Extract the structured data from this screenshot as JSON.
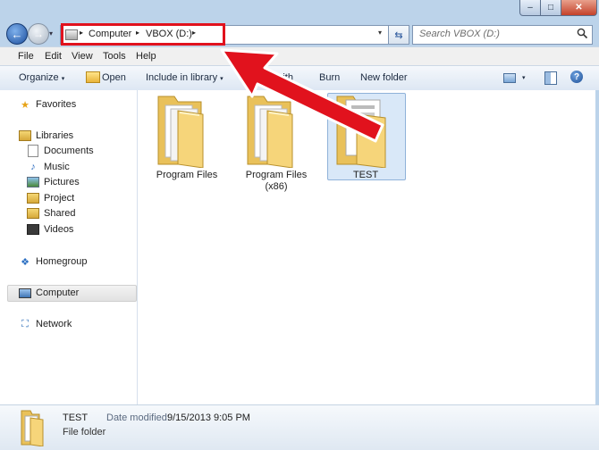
{
  "window": {
    "minimize_glyph": "–",
    "maximize_glyph": "□",
    "close_glyph": "✕"
  },
  "nav": {
    "back_glyph": "←",
    "forward_glyph": "→",
    "history_glyph": "▾"
  },
  "address": {
    "crumbs": [
      "Computer",
      "VBOX (D:)"
    ],
    "separator_glyph": "▸",
    "dropdown_glyph": "▾",
    "refresh_glyph": "⇆"
  },
  "search": {
    "placeholder": "Search VBOX (D:)",
    "icon": "search-icon"
  },
  "menu": [
    "File",
    "Edit",
    "View",
    "Tools",
    "Help"
  ],
  "toolbar": {
    "organize": "Organize",
    "open": "Open",
    "include_library": "Include in library",
    "share_with": "Share with",
    "burn": "Burn",
    "new_folder": "New folder",
    "caret": "▾",
    "view_caret": "▾",
    "help_glyph": "?"
  },
  "sidebar": {
    "favorites": "Favorites",
    "libraries": "Libraries",
    "library_items": [
      "Documents",
      "Music",
      "Pictures",
      "Project",
      "Shared",
      "Videos"
    ],
    "homegroup": "Homegroup",
    "computer": "Computer",
    "network": "Network"
  },
  "folders": [
    {
      "name_line1": "Program Files",
      "name_line2": ""
    },
    {
      "name_line1": "Program Files",
      "name_line2": "(x86)"
    },
    {
      "name_line1": "TEST",
      "name_line2": ""
    }
  ],
  "details": {
    "name": "TEST",
    "date_label": "Date modified:",
    "date_value": "9/15/2013 9:05 PM",
    "type": "File folder"
  },
  "colors": {
    "annotation_red": "#e1121d",
    "folder_yellow": "#f0cd6a",
    "selection_blue": "#d9e8f8"
  }
}
